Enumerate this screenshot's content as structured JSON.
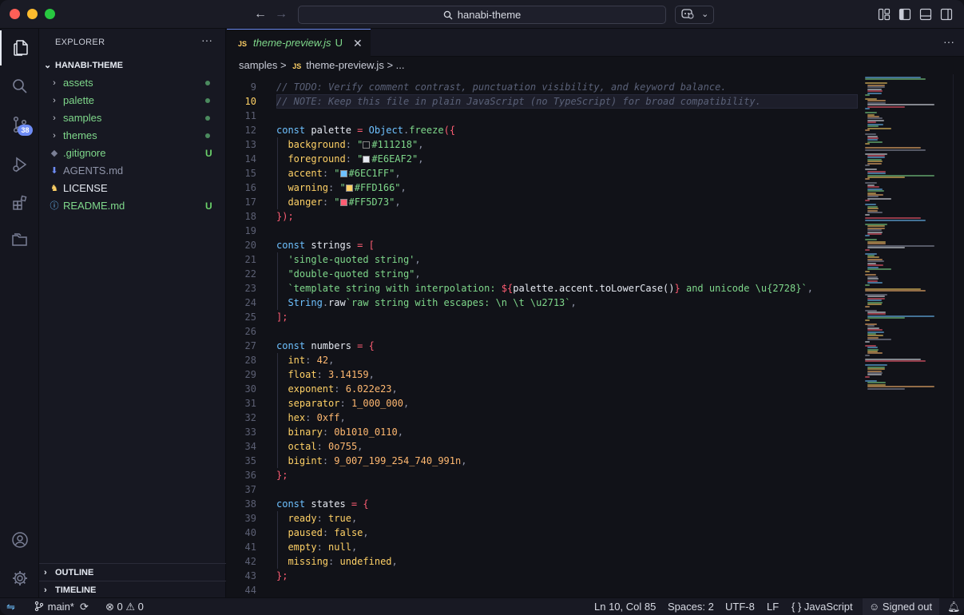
{
  "window": {
    "search_text": "hanabi-theme"
  },
  "explorer": {
    "title": "EXPLORER",
    "more": "···",
    "root": "HANABI-THEME",
    "items": [
      {
        "label": "assets",
        "kind": "folder",
        "status": "dot"
      },
      {
        "label": "palette",
        "kind": "folder",
        "status": "dot"
      },
      {
        "label": "samples",
        "kind": "folder",
        "status": "dot"
      },
      {
        "label": "themes",
        "kind": "folder",
        "status": "dot"
      },
      {
        "label": ".gitignore",
        "kind": "file",
        "status": "U"
      },
      {
        "label": "AGENTS.md",
        "kind": "file",
        "status": ""
      },
      {
        "label": "LICENSE",
        "kind": "file",
        "status": ""
      },
      {
        "label": "README.md",
        "kind": "file",
        "status": "U"
      }
    ],
    "outline": "OUTLINE",
    "timeline": "TIMELINE"
  },
  "activity": {
    "badge": "38"
  },
  "editor": {
    "tab": {
      "icon": "JS",
      "name": "theme-preview.js",
      "status": "U"
    },
    "breadcrumb": {
      "folder": "samples",
      "sep": ">",
      "icon": "JS",
      "file": "theme-preview.js",
      "tail": "> ..."
    },
    "current_line": 10,
    "colors": {
      "background": "#111218",
      "foreground": "#E6EAF2",
      "accent": "#6EC1FF",
      "warning": "#FFD166",
      "danger": "#FF5D73"
    },
    "lines": [
      {
        "n": 9,
        "t": "// TODO: Verify comment contrast, punctuation visibility, and keyword balance."
      },
      {
        "n": 10,
        "t": "// NOTE: Keep this file in plain JavaScript (no TypeScript) for broad compatibility."
      },
      {
        "n": 11,
        "t": ""
      },
      {
        "n": 12,
        "t": "const palette = Object.freeze({"
      },
      {
        "n": 13,
        "t": "  background: \"#111218\","
      },
      {
        "n": 14,
        "t": "  foreground: \"#E6EAF2\","
      },
      {
        "n": 15,
        "t": "  accent: \"#6EC1FF\","
      },
      {
        "n": 16,
        "t": "  warning: \"#FFD166\","
      },
      {
        "n": 17,
        "t": "  danger: \"#FF5D73\","
      },
      {
        "n": 18,
        "t": "});"
      },
      {
        "n": 19,
        "t": ""
      },
      {
        "n": 20,
        "t": "const strings = ["
      },
      {
        "n": 21,
        "t": "  'single-quoted string',"
      },
      {
        "n": 22,
        "t": "  \"double-quoted string\","
      },
      {
        "n": 23,
        "t": "  `template string with interpolation: ${palette.accent.toLowerCase()} and unicode \\u{2728}`,"
      },
      {
        "n": 24,
        "t": "  String.raw`raw string with escapes: \\n \\t \\u2713`,"
      },
      {
        "n": 25,
        "t": "];"
      },
      {
        "n": 26,
        "t": ""
      },
      {
        "n": 27,
        "t": "const numbers = {"
      },
      {
        "n": 28,
        "t": "  int: 42,"
      },
      {
        "n": 29,
        "t": "  float: 3.14159,"
      },
      {
        "n": 30,
        "t": "  exponent: 6.022e23,"
      },
      {
        "n": 31,
        "t": "  separator: 1_000_000,"
      },
      {
        "n": 32,
        "t": "  hex: 0xff,"
      },
      {
        "n": 33,
        "t": "  binary: 0b1010_0110,"
      },
      {
        "n": 34,
        "t": "  octal: 0o755,"
      },
      {
        "n": 35,
        "t": "  bigint: 9_007_199_254_740_991n,"
      },
      {
        "n": 36,
        "t": "};"
      },
      {
        "n": 37,
        "t": ""
      },
      {
        "n": 38,
        "t": "const states = {"
      },
      {
        "n": 39,
        "t": "  ready: true,"
      },
      {
        "n": 40,
        "t": "  paused: false,"
      },
      {
        "n": 41,
        "t": "  empty: null,"
      },
      {
        "n": 42,
        "t": "  missing: undefined,"
      },
      {
        "n": 43,
        "t": "};"
      },
      {
        "n": 44,
        "t": ""
      }
    ]
  },
  "status": {
    "branch": "main*",
    "errors": "0",
    "warnings": "0",
    "position": "Ln 10, Col 85",
    "spaces": "Spaces: 2",
    "encoding": "UTF-8",
    "eol": "LF",
    "language": "JavaScript",
    "lang_icon": "{ }",
    "account": "Signed out"
  }
}
